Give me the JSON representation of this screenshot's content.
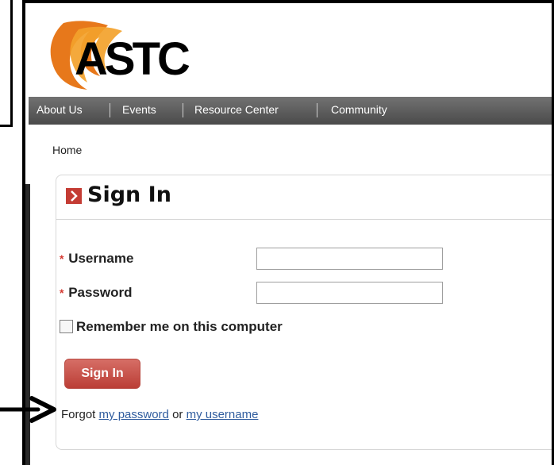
{
  "brand": {
    "logo_text": "ASTC"
  },
  "nav": {
    "items": [
      {
        "label": "About Us"
      },
      {
        "label": "Events"
      },
      {
        "label": "Resource Center"
      },
      {
        "label": "Community"
      }
    ]
  },
  "breadcrumb": {
    "home": "Home"
  },
  "signin": {
    "title": "Sign In",
    "username_label": "Username",
    "password_label": "Password",
    "required_mark": "*",
    "username_value": "",
    "password_value": "",
    "remember_label": "Remember me on this computer",
    "button_label": "Sign In",
    "forgot_prefix": "Forgot",
    "forgot_password_link": "my password",
    "forgot_or": "or",
    "forgot_username_link": "my username"
  },
  "colors": {
    "accent": "#c43c34",
    "link": "#2f5c9e",
    "nav_bg": "#5a5a5a"
  },
  "icons": {
    "section_chevron": "chevron-right-icon",
    "annotation_arrow": "arrow-right-icon"
  }
}
